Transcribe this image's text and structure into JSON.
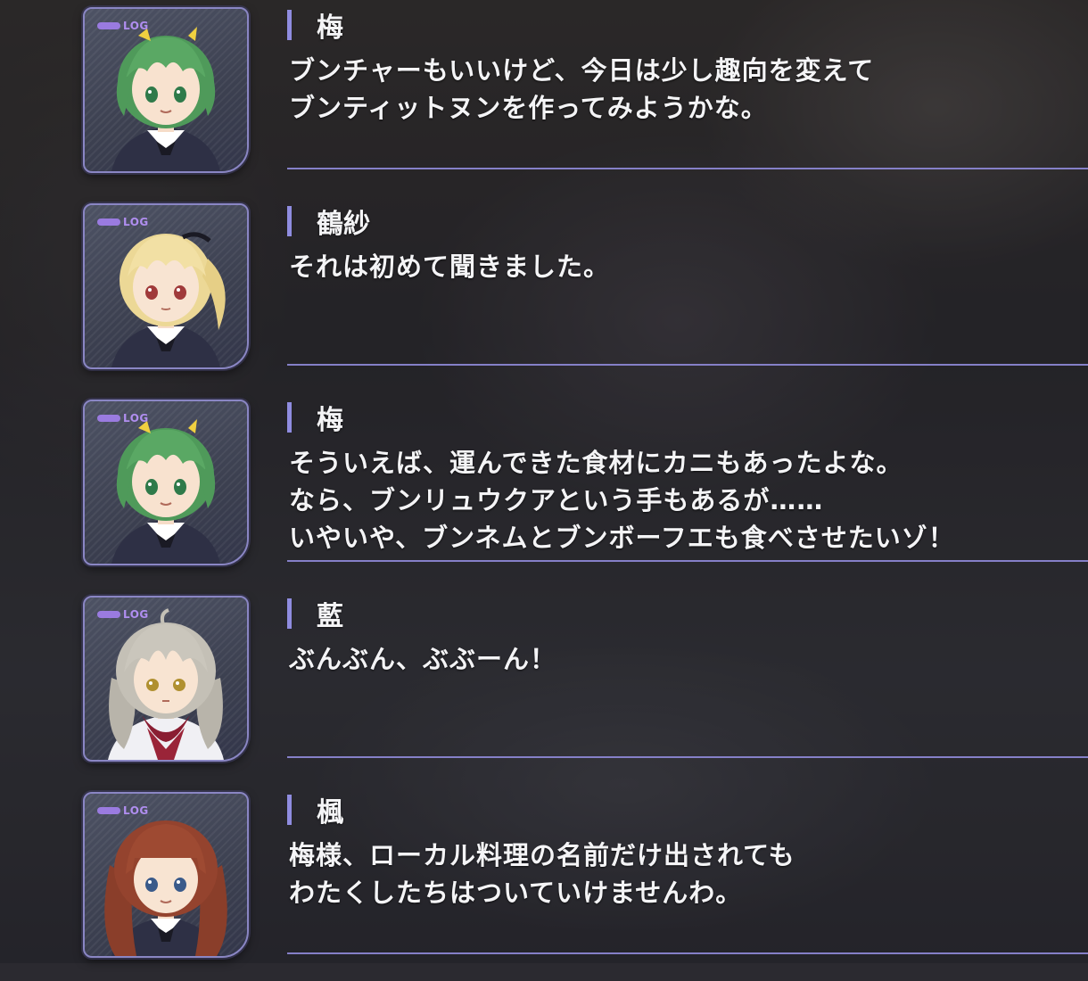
{
  "log_entries": [
    {
      "badge": "LOG",
      "speaker": "梅",
      "portrait": "character-umi-icon",
      "lines": [
        "ブンチャーもいいけど、今日は少し趣向を変えて",
        "ブンティットヌンを作ってみようかな。"
      ]
    },
    {
      "badge": "LOG",
      "speaker": "鶴紗",
      "portrait": "character-tazusa-icon",
      "lines": [
        "それは初めて聞きました。"
      ]
    },
    {
      "badge": "LOG",
      "speaker": "梅",
      "portrait": "character-umi-icon",
      "lines": [
        "そういえば、運んできた食材にカニもあったよな。",
        "なら、ブンリュウクアという手もあるが……",
        "いやいや、ブンネムとブンボーフエも食べさせたいゾ！"
      ]
    },
    {
      "badge": "LOG",
      "speaker": "藍",
      "portrait": "character-ran-icon",
      "lines": [
        "ぶんぶん、ぶぶーん！"
      ]
    },
    {
      "badge": "LOG",
      "speaker": "楓",
      "portrait": "character-kaede-icon",
      "lines": [
        "梅様、ローカル料理の名前だけ出されても",
        "わたくしたちはついていけませんわ。"
      ]
    }
  ],
  "colors": {
    "accent": "#8f8ce0",
    "divider": "#8580c8",
    "log_badge": "#b08ef0",
    "text": "#f4f4f6"
  }
}
